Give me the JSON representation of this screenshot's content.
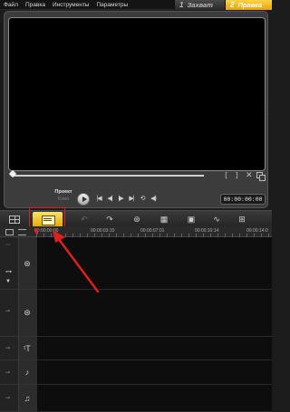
{
  "menu": {
    "items": [
      "Файл",
      "Правка",
      "Инструменты",
      "Параметры"
    ]
  },
  "modes": {
    "capture": {
      "num": "1",
      "label": "Захват"
    },
    "edit": {
      "num": "2",
      "label": "Правка"
    }
  },
  "player": {
    "mode_project": "Проект",
    "mode_clip": "Клип",
    "timecode": "00:00:00:00",
    "mark_in": "[",
    "mark_out": "]"
  },
  "ruler": {
    "ticks": [
      "00:00:00:00",
      "00:00:03:10",
      "00:00:07:01",
      "00:00:10:14",
      "00:00:14:0"
    ]
  },
  "colors": {
    "accent": "#ffc21a",
    "highlight": "#e02020",
    "background": "#1c1c1c"
  }
}
